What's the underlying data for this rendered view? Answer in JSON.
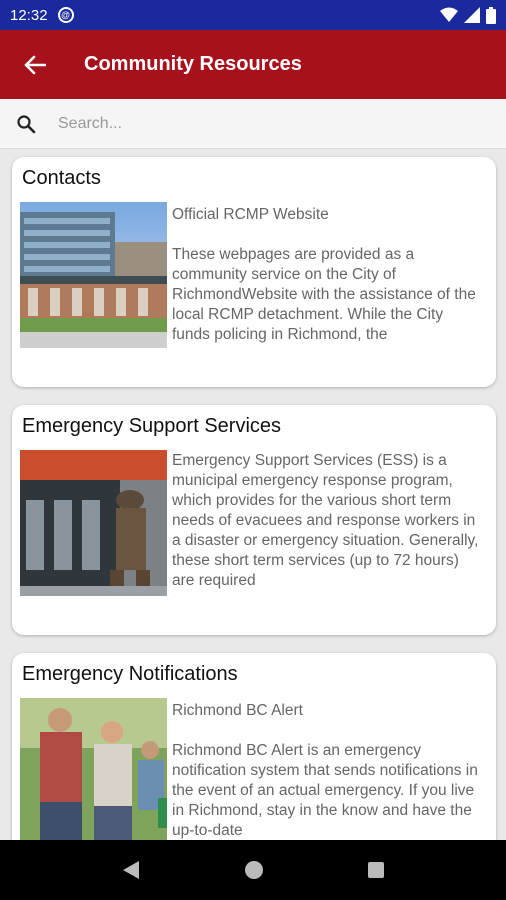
{
  "status": {
    "time": "12:32",
    "sync_glyph": "@"
  },
  "appbar": {
    "title": "Community Resources"
  },
  "search": {
    "placeholder": "Search..."
  },
  "cards": [
    {
      "title": "Contacts",
      "subtitle": "Official RCMP Website",
      "description": "These webpages are provided as a community service on the City of RichmondWebsite with the assistance of the local RCMP detachment. While the City funds policing in Richmond, the"
    },
    {
      "title": "Emergency Support Services",
      "subtitle": "",
      "description": "Emergency Support Services (ESS) is a municipal emergency response program, which provides for the various short term needs of evacuees and response workers in a disaster or emergency situation. Generally, these short term services (up to 72 hours) are required"
    },
    {
      "title": "Emergency Notifications",
      "subtitle": "Richmond BC Alert",
      "description": "Richmond BC Alert is an emergency notification system that sends notifications in the event of an actual emergency. If you live in Richmond, stay in the know and have the up-to-date"
    }
  ],
  "colors": {
    "statusbar": "#1a2a9c",
    "appbar": "#a6111c",
    "background": "#e9e9e9"
  },
  "icons": {
    "status": [
      "sync-icon",
      "wifi-icon",
      "signal-icon",
      "battery-icon"
    ],
    "appbar": "back-arrow-icon",
    "search": "search-icon",
    "nav": [
      "back-triangle-icon",
      "home-circle-icon",
      "recents-square-icon"
    ]
  }
}
